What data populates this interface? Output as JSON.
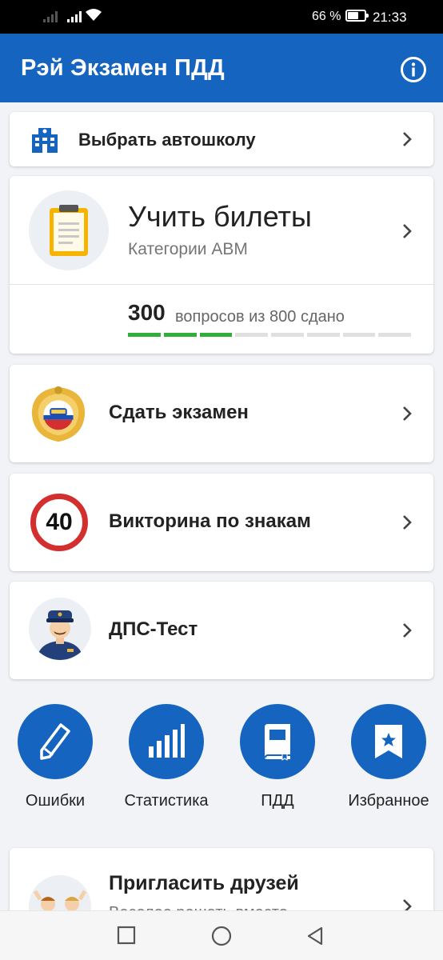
{
  "status_bar": {
    "battery_text": "66 %",
    "battery_level": 0.66,
    "time": "21:33"
  },
  "app_bar": {
    "title": "Рэй Экзамен ПДД",
    "info_icon": "info-icon"
  },
  "driving_school": {
    "label": "Выбрать автошколу",
    "icon": "school-building-icon"
  },
  "learn_tickets": {
    "title": "Учить билеты",
    "subtitle": "Категории ABM",
    "progress_count": "300",
    "progress_text": "вопросов из 800 сдано",
    "progress_fraction": 0.375,
    "segments_total": 8,
    "segments_done": 3,
    "icon": "clipboard-icon"
  },
  "exam": {
    "label": "Сдать экзамен",
    "icon": "gibdd-emblem-icon"
  },
  "quiz": {
    "label": "Викторина по знакам",
    "sign_value": "40",
    "icon": "speed-limit-sign-icon"
  },
  "dps": {
    "label": "ДПС-Тест",
    "icon": "traffic-officer-icon"
  },
  "quick_actions": [
    {
      "label": "Ошибки",
      "icon": "pencil-icon"
    },
    {
      "label": "Статистика",
      "icon": "bar-chart-icon"
    },
    {
      "label": "ПДД",
      "icon": "book-icon"
    },
    {
      "label": "Избранное",
      "icon": "bookmark-star-icon"
    }
  ],
  "invite": {
    "title": "Пригласить друзей",
    "subtitle": "Веселее решать вместе",
    "icon": "friends-icon"
  },
  "colors": {
    "primary": "#1565c0",
    "progress_done": "#2fae3a",
    "sign_red": "#d32f2f",
    "background": "#f1f3f6"
  }
}
